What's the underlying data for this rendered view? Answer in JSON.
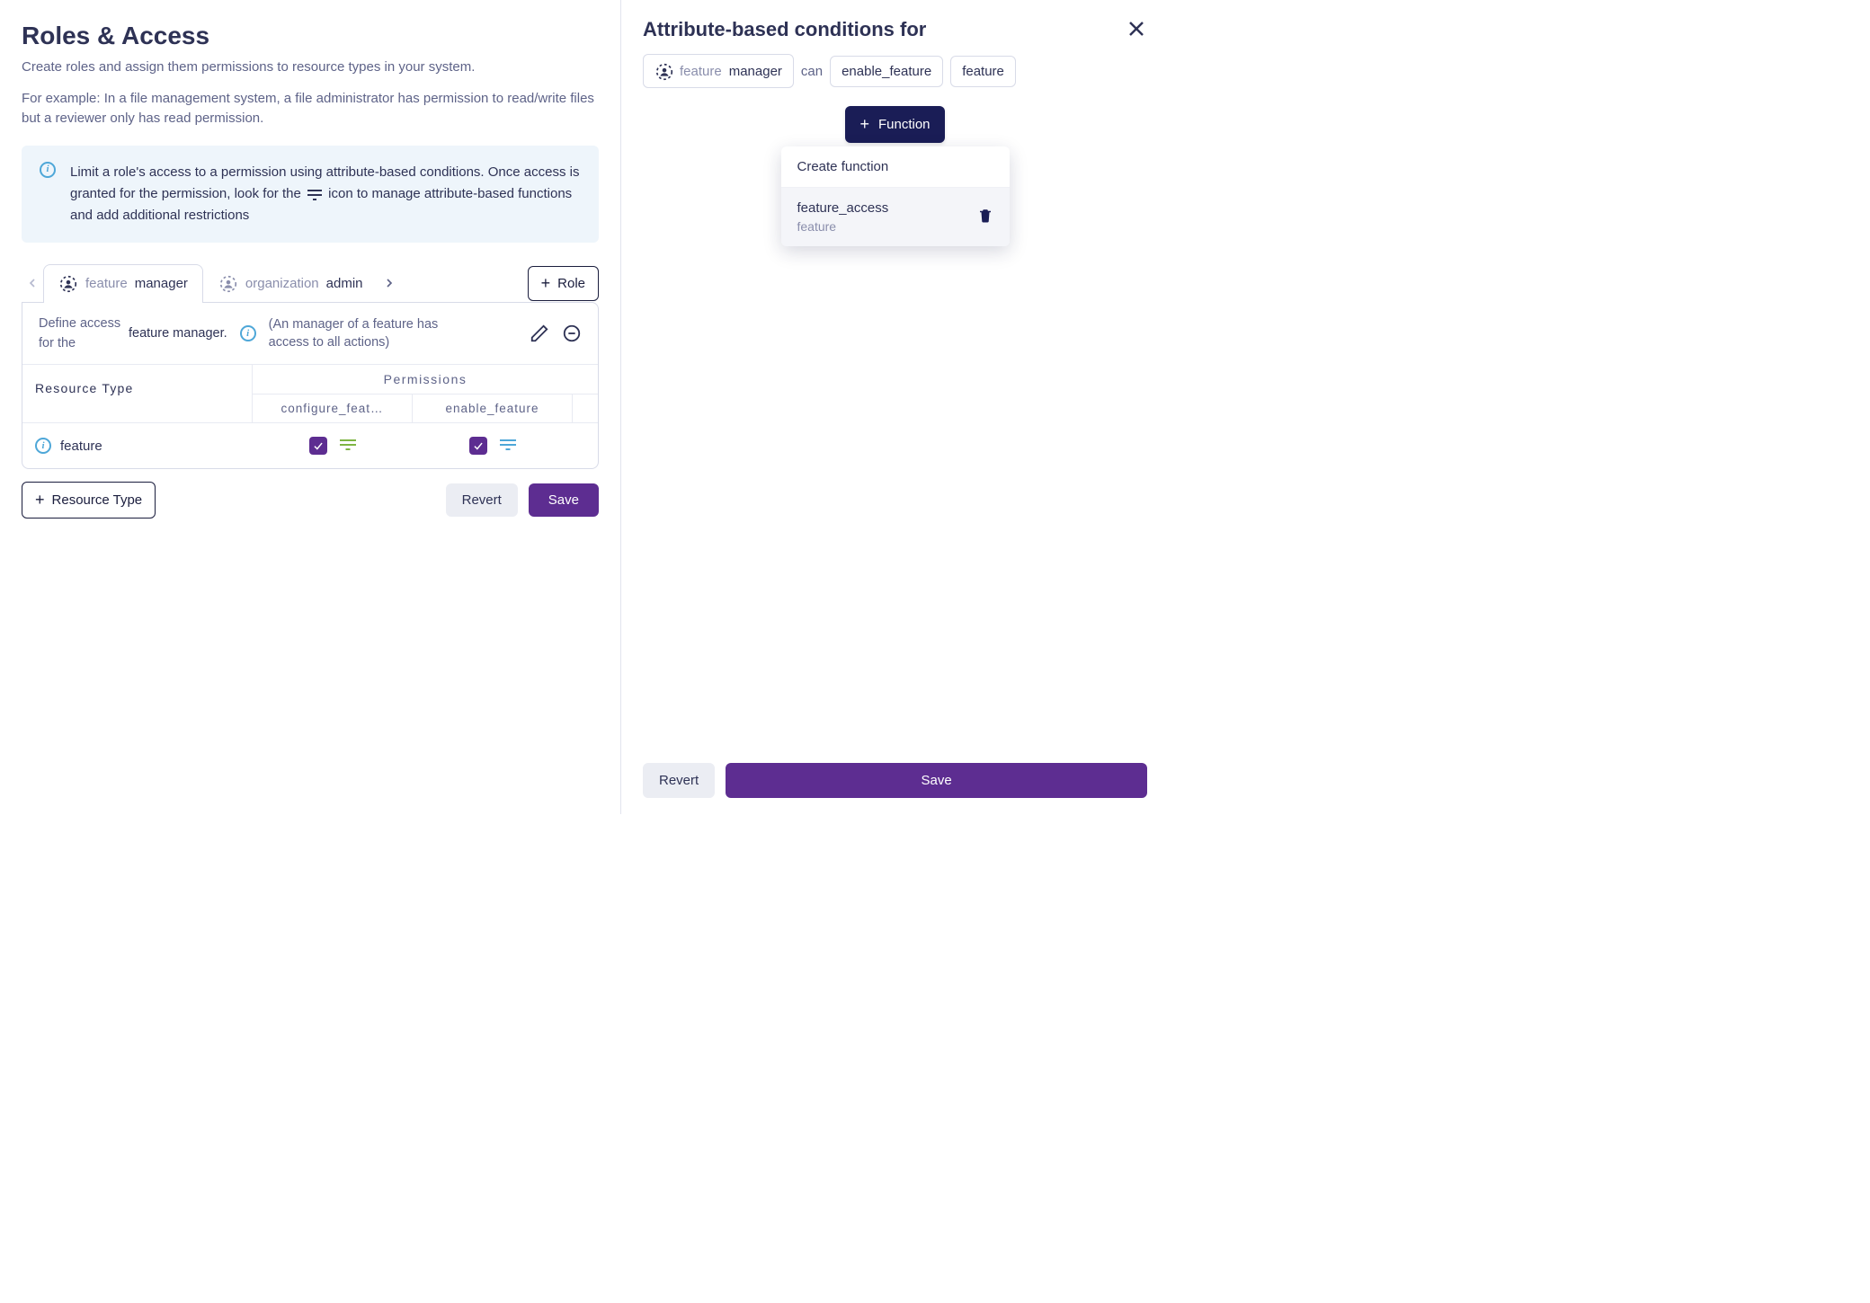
{
  "left": {
    "title": "Roles & Access",
    "desc1": "Create roles and assign them permissions to resource types in your system.",
    "desc2": "For example: In a file management system, a file administrator has permission to read/write files but a reviewer only has read permission.",
    "info_pre": "Limit a role's access to a permission using attribute-based conditions. Once access is granted for the permission, look for the ",
    "info_post": " icon to manage attribute-based functions and add additional restrictions",
    "tabs": [
      {
        "prefix": "feature",
        "suffix": "manager"
      },
      {
        "prefix": "organization",
        "suffix": "admin"
      }
    ],
    "role_button": "Role",
    "define_pre": "Define access for the",
    "define_role": "feature manager",
    "define_hint": "(An manager of a feature has access to all actions)",
    "col_resource_type": "Resource Type",
    "col_permissions": "Permissions",
    "perm_cols": [
      "configure_feat…",
      "enable_feature"
    ],
    "resource_row": "feature",
    "btn_resource_type": "Resource Type",
    "btn_revert": "Revert",
    "btn_save": "Save"
  },
  "right": {
    "title": "Attribute-based conditions for",
    "chip_role_prefix": "feature",
    "chip_role_suffix": "manager",
    "word_can": "can",
    "chip_action": "enable_feature",
    "chip_resource": "feature",
    "btn_function": "Function",
    "dd_create": "Create function",
    "dd_fn_name": "feature_access",
    "dd_fn_sub": "feature",
    "btn_revert": "Revert",
    "btn_save": "Save"
  }
}
